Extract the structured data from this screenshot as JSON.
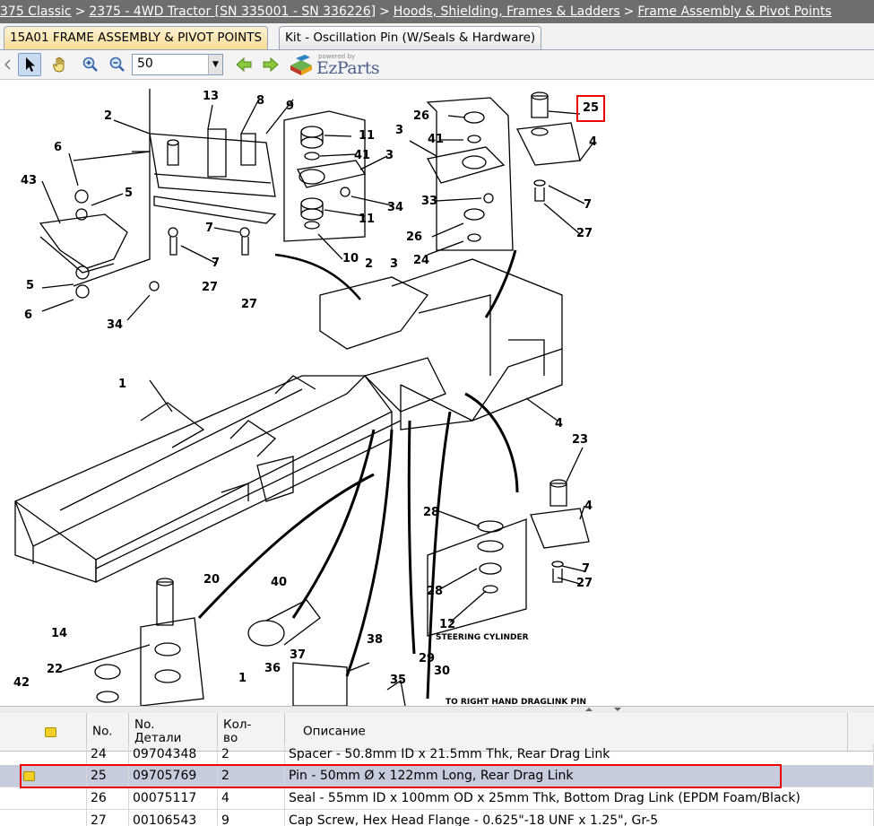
{
  "breadcrumb": {
    "items": [
      "375 Classic",
      "2375 - 4WD Tractor [SN 335001 - SN 336226]",
      "Hoods, Shielding, Frames & Ladders",
      "Frame Assembly & Pivot Points"
    ],
    "separator": ">"
  },
  "tabs": [
    {
      "label": "15A01 FRAME ASSEMBLY & PIVOT POINTS",
      "active": true
    },
    {
      "label": "Kit - Oscillation Pin (W/Seals & Hardware)",
      "active": false
    }
  ],
  "toolbar": {
    "tools": [
      "arrow-pointer-icon",
      "hand-pan-icon",
      "zoom-in-icon",
      "zoom-out-icon"
    ],
    "zoom_value": "50",
    "logo_powered": "powered by",
    "logo_text": "EzParts"
  },
  "diagram": {
    "callouts": [
      "2",
      "13",
      "8",
      "9",
      "6",
      "43",
      "5",
      "5",
      "6",
      "34",
      "7",
      "7",
      "27",
      "27",
      "11",
      "41",
      "3",
      "34",
      "11",
      "10",
      "2",
      "3",
      "26",
      "41",
      "3",
      "33",
      "26",
      "24",
      "25",
      "4",
      "7",
      "27",
      "1",
      "4",
      "23",
      "28",
      "4",
      "7",
      "28",
      "27",
      "12",
      "20",
      "40",
      "14",
      "22",
      "42",
      "37",
      "36",
      "1",
      "38",
      "35",
      "29",
      "30"
    ],
    "highlighted_callout": "25",
    "steering_label": "STEERING CYLINDER",
    "bottom_note": "TO RIGHT HAND DRAGLINK PIN"
  },
  "table": {
    "headers": {
      "icon": "",
      "no": "No.",
      "part": "No. Детали",
      "qty": "Кол-во",
      "desc": "Описание"
    },
    "rows": [
      {
        "no": "24",
        "part": "09704348",
        "qty": "2",
        "desc": "Spacer - 50.8mm ID x 21.5mm Thk, Rear Drag Link",
        "icon": false,
        "selected": false
      },
      {
        "no": "25",
        "part": "09705769",
        "qty": "2",
        "desc": "Pin - 50mm Ø x 122mm Long, Rear Drag Link",
        "icon": true,
        "selected": true
      },
      {
        "no": "26",
        "part": "00075117",
        "qty": "4",
        "desc": "Seal - 55mm ID x 100mm OD x 25mm Thk, Bottom Drag Link (EPDM Foam/Black)",
        "icon": false,
        "selected": false
      },
      {
        "no": "27",
        "part": "00106543",
        "qty": "9",
        "desc": "Cap Screw, Hex Head Flange - 0.625\"-18 UNF x 1.25\", Gr-5",
        "icon": false,
        "selected": false
      }
    ]
  },
  "colors": {
    "highlight": "#e00000",
    "selected_row": "#c7ccdd",
    "breadcrumb_bg": "#6e6e6e"
  }
}
